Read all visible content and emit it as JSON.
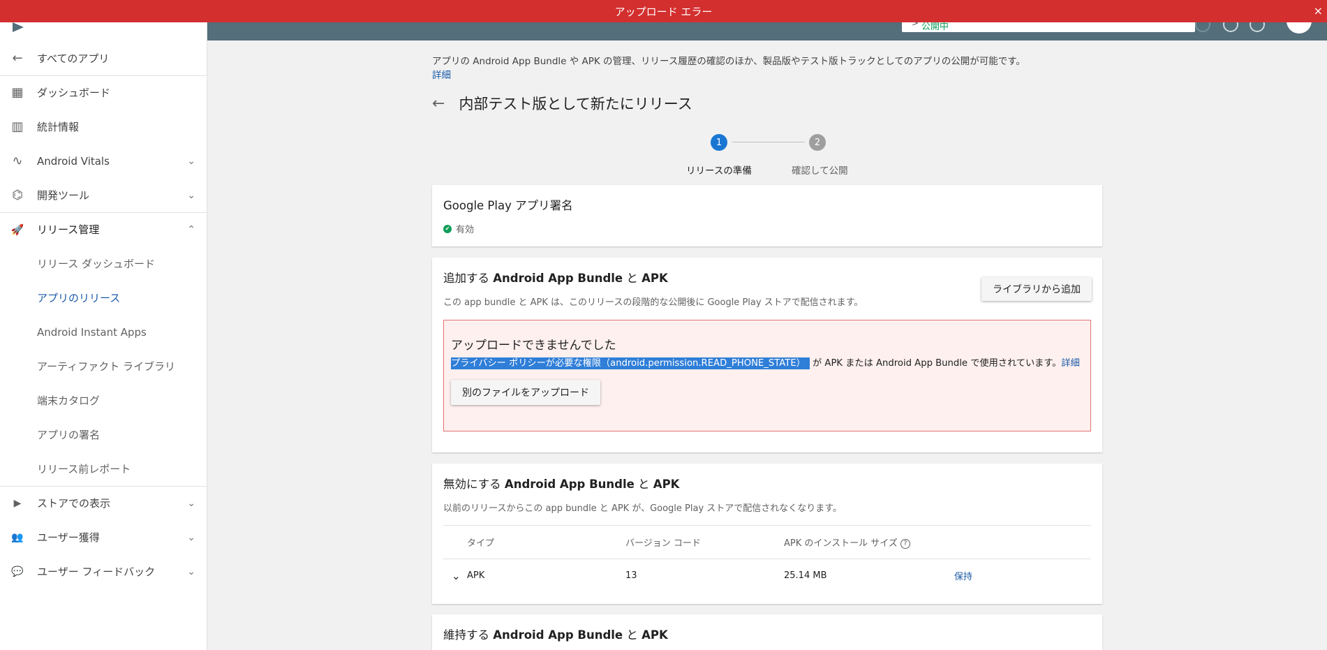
{
  "banner": {
    "text": "アップロード エラー",
    "close": "×"
  },
  "topbar": {
    "status_chevron": ">",
    "status": "公開中"
  },
  "sidebar": {
    "items": [
      {
        "label": "すべてのアプリ",
        "icon": "←"
      },
      {
        "label": "ダッシュボード",
        "icon": "▦"
      },
      {
        "label": "統計情報",
        "icon": "▥"
      },
      {
        "label": "Android Vitals",
        "icon": "∿",
        "arrow": "⌄"
      },
      {
        "label": "開発ツール",
        "icon": "⌬",
        "arrow": "⌄"
      },
      {
        "label": "リリース管理",
        "icon": "🚀",
        "arrow": "⌃"
      },
      {
        "label": "リリース ダッシュボード"
      },
      {
        "label": "アプリのリリース"
      },
      {
        "label": "Android Instant Apps"
      },
      {
        "label": "アーティファクト ライブラリ"
      },
      {
        "label": "端末カタログ"
      },
      {
        "label": "アプリの署名"
      },
      {
        "label": "リリース前レポート"
      },
      {
        "label": "ストアでの表示",
        "icon": "▶",
        "arrow": "⌄"
      },
      {
        "label": "ユーザー獲得",
        "icon": "👥",
        "arrow": "⌄"
      },
      {
        "label": "ユーザー フィードバック",
        "icon": "💬",
        "arrow": "⌄"
      }
    ]
  },
  "main": {
    "description": "アプリの Android App Bundle や APK の管理、リリース履歴の確認のほか、製品版やテスト版トラックとしてのアプリの公開が可能です。",
    "details_link": "詳細",
    "back_arrow": "←",
    "title": "内部テスト版として新たにリリース",
    "steps": [
      {
        "num": "1",
        "label": "リリースの準備",
        "color": "#1976d2"
      },
      {
        "num": "2",
        "label": "確認して公開",
        "color": "#9e9e9e"
      }
    ]
  },
  "signing_card": {
    "title": "Google Play アプリ署名",
    "status_icon": "✔",
    "status": "有効"
  },
  "add_card": {
    "title_prefix": "追加する",
    "title_bold": "Android App Bundle",
    "title_mid": " と ",
    "title_bold2": "APK",
    "subtitle": "この app bundle と APK は、このリリースの段階的な公開後に Google Play ストアで配信されます。",
    "library_button": "ライブラリから追加",
    "error": {
      "heading": "アップロードできませんでした",
      "highlighted": "プライバシー ポリシーが必要な権限（android.permission.READ_PHONE_STATE）",
      "rest": "が APK または Android App Bundle で使用されています。",
      "link": "詳細",
      "upload_button": "別のファイルをアップロード"
    }
  },
  "disable_card": {
    "title_prefix": "無効にする",
    "title_bold": "Android App Bundle",
    "title_mid": " と ",
    "title_bold2": "APK",
    "subtitle": "以前のリリースからこの app bundle と APK が、Google Play ストアで配信されなくなります。",
    "columns": [
      "タイプ",
      "バージョン コード",
      "APK のインストール サイズ"
    ],
    "help_icon": "?",
    "rows": [
      {
        "chevron": "⌄",
        "type": "APK",
        "version": "13",
        "size": "25.14 MB",
        "action": "保持"
      }
    ]
  },
  "retain_card": {
    "title_prefix": "維持する",
    "title_bold": "Android App Bundle",
    "title_mid": " と ",
    "title_bold2": "APK"
  }
}
